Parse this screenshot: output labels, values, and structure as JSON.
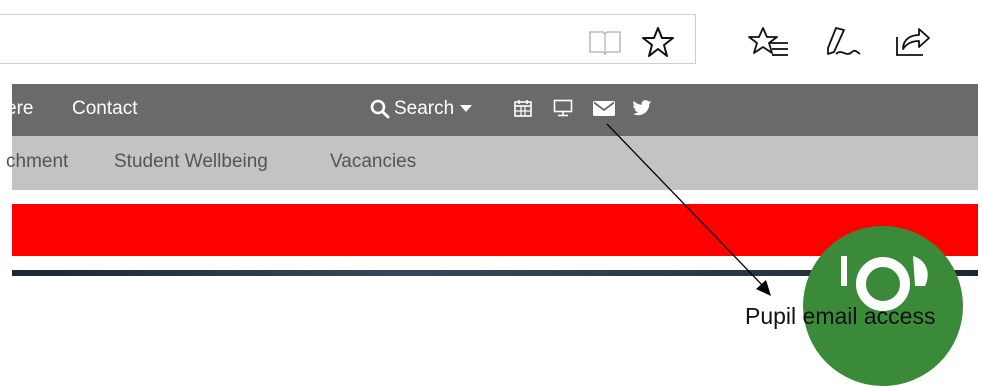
{
  "nav": {
    "links": [
      "ere",
      "Contact"
    ],
    "search_label": "Search"
  },
  "subnav": {
    "links": [
      "chment",
      "Student Wellbeing",
      "Vacancies"
    ]
  },
  "annotation": {
    "text": "Pupil email access"
  },
  "colors": {
    "navbar": "#6a6a6a",
    "subnav": "#c3c3c3",
    "redbar": "#ff0000",
    "logo": "#3a8a3a"
  },
  "icons": {
    "toolbar": [
      "reading-view-icon",
      "favorite-star-icon",
      "favorites-list-icon",
      "pen-icon",
      "share-icon"
    ],
    "nav": [
      "search-icon",
      "caret-down-icon",
      "calendar-icon",
      "monitor-icon",
      "mail-icon",
      "twitter-icon"
    ]
  }
}
